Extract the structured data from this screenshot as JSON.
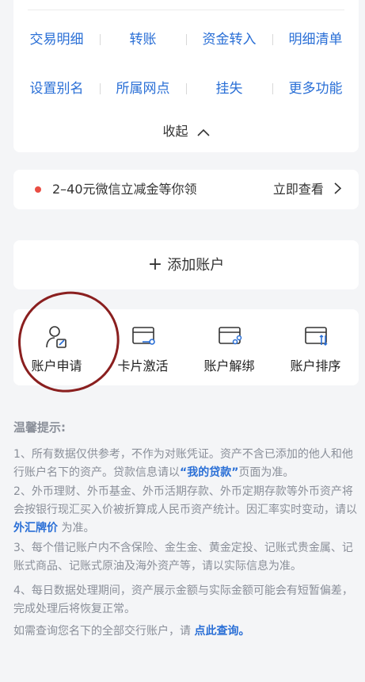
{
  "account_actions": {
    "row1": [
      "交易明细",
      "转账",
      "资金转入",
      "明细清单"
    ],
    "row2": [
      "设置别名",
      "所属网点",
      "挂失",
      "更多功能"
    ]
  },
  "collapse_label": "收起",
  "promo": {
    "text": "2–40元微信立减金等你领",
    "link": "立即查看"
  },
  "add_account": {
    "plus": "+",
    "label": "添加账户"
  },
  "tools": [
    "账户申请",
    "卡片激活",
    "账户解绑",
    "账户排序"
  ],
  "tips": {
    "title": "温馨提示:",
    "t1_a": "1、所有数据仅供参考，不作为对账凭证。资产不含已添加的他人和他行账户名下的资产。贷款信息请以",
    "t1_link": "“我的贷款”",
    "t1_b": "页面为准。",
    "t2_a": "2、外币理财、外币基金、外币活期存款、外币定期存款等外币资产将会按银行现汇买入价被折算成人民币资产统计。因汇率实时变动，请以",
    "t2_link": "外汇牌价",
    "t2_b": "为准。",
    "t3": "3、每个借记账户内不含保险、金生金、黄金定投、记账式贵金属、记账式商品、记账式原油及海外资产等，请以实际信息为准。",
    "t4": "4、每日数据处理期间，资产展示金额与实际金额可能会有短暂偏差，完成处理后将恢复正常。",
    "t5_a": "如需查询您名下的全部交行账户，请",
    "t5_link": "点此查询。"
  },
  "colors": {
    "accent": "#2a6fd6",
    "promo_dot": "#e94d43",
    "annotation": "#8a1f1f"
  }
}
